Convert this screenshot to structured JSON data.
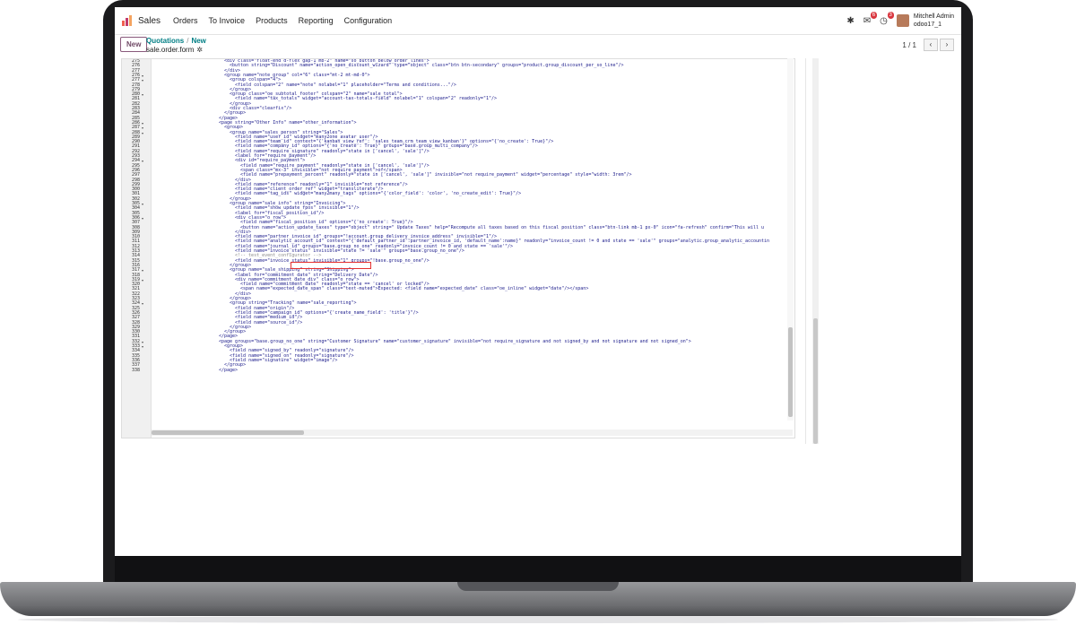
{
  "navbar": {
    "app_name": "Sales",
    "menu": [
      "Orders",
      "To Invoice",
      "Products",
      "Reporting",
      "Configuration"
    ],
    "chat_badge": "6",
    "activity_badge": "3",
    "user_name": "Mitchell Admin",
    "db_name": "odoo17_1",
    "icons": [
      "bug-icon",
      "chat-icon",
      "clock-icon"
    ]
  },
  "control": {
    "new_label": "New",
    "breadcrumb_parent": "Quotations",
    "breadcrumb_sep": "/",
    "breadcrumb_current": "New",
    "record_name": "sale.order.form",
    "pager": "1 / 1"
  },
  "code_lines": [
    {
      "n": "275",
      "fold": false,
      "indent": 96,
      "text": "<div class=\"float-end d-flex gap-1 mb-2\" name=\"so_button_below_order_lines\">"
    },
    {
      "n": "276",
      "fold": false,
      "indent": 102,
      "text": "<button string=\"Discount\" name=\"action_open_discount_wizard\" type=\"object\" class=\"btn btn-secondary\" groups=\"product.group_discount_per_so_line\"/>"
    },
    {
      "n": "277",
      "fold": false,
      "indent": 96,
      "text": "</div>"
    },
    {
      "n": "276",
      "fold": true,
      "indent": 96,
      "text": "<group name=\"note_group\" col=\"6\" class=\"mt-2 mt-md-0\">"
    },
    {
      "n": "277",
      "fold": true,
      "indent": 102,
      "text": "<group colspan=\"4\">"
    },
    {
      "n": "278",
      "fold": false,
      "indent": 108,
      "text": "<field colspan=\"2\" name=\"note\" nolabel=\"1\" placeholder=\"Terms and conditions...\"/>"
    },
    {
      "n": "279",
      "fold": false,
      "indent": 102,
      "text": "</group>"
    },
    {
      "n": "280",
      "fold": true,
      "indent": 102,
      "text": "<group class=\"oe_subtotal_footer\" colspan=\"2\" name=\"sale_total\">"
    },
    {
      "n": "281",
      "fold": false,
      "indent": 108,
      "text": "<field name=\"tax_totals\" widget=\"account-tax-totals-field\" nolabel=\"1\" colspan=\"2\" readonly=\"1\"/>"
    },
    {
      "n": "282",
      "fold": false,
      "indent": 102,
      "text": "</group>"
    },
    {
      "n": "283",
      "fold": false,
      "indent": 102,
      "text": "<div class=\"clearfix\"/>"
    },
    {
      "n": "284",
      "fold": false,
      "indent": 96,
      "text": "</group>"
    },
    {
      "n": "285",
      "fold": false,
      "indent": 90,
      "text": "</page>"
    },
    {
      "n": "286",
      "fold": true,
      "indent": 90,
      "text": "<page string=\"Other Info\" name=\"other_information\">"
    },
    {
      "n": "287",
      "fold": true,
      "indent": 96,
      "text": "<group>"
    },
    {
      "n": "288",
      "fold": true,
      "indent": 102,
      "text": "<group name=\"sales_person\" string=\"Sales\">"
    },
    {
      "n": "289",
      "fold": false,
      "indent": 108,
      "text": "<field name=\"user_id\" widget=\"many2one_avatar_user\"/>"
    },
    {
      "n": "290",
      "fold": false,
      "indent": 108,
      "text": "<field name=\"team_id\" context=\"{'kanban_view_ref': 'sales_team.crm_team_view_kanban'}\" options=\"{'no_create': True}\"/>"
    },
    {
      "n": "291",
      "fold": false,
      "indent": 108,
      "text": "<field name=\"company_id\" options=\"{'no_create': True}\" groups=\"base.group_multi_company\"/>"
    },
    {
      "n": "292",
      "fold": false,
      "indent": 108,
      "text": "<field name=\"require_signature\" readonly=\"state in ['cancel', 'sale']\"/>"
    },
    {
      "n": "293",
      "fold": false,
      "indent": 108,
      "text": "<label for=\"require_payment\"/>"
    },
    {
      "n": "294",
      "fold": true,
      "indent": 108,
      "text": "<div id=\"require_payment\">"
    },
    {
      "n": "295",
      "fold": false,
      "indent": 114,
      "text": "<field name=\"require_payment\" readonly=\"state in ['cancel', 'sale']\"/>"
    },
    {
      "n": "296",
      "fold": false,
      "indent": 114,
      "text": "<span class=\"mx-3\" invisible=\"not require_payment\">of</span>"
    },
    {
      "n": "297",
      "fold": false,
      "indent": 114,
      "text": "<field name=\"prepayment_percent\" readonly=\"state in ['cancel', 'sale']\" invisible=\"not require_payment\" widget=\"percentage\" style=\"width: 3rem\"/>"
    },
    {
      "n": "298",
      "fold": false,
      "indent": 108,
      "text": "</div>"
    },
    {
      "n": "299",
      "fold": false,
      "indent": 108,
      "text": "<field name=\"reference\" readonly=\"1\" invisible=\"not reference\"/>"
    },
    {
      "n": "300",
      "fold": false,
      "indent": 108,
      "text": "<field name=\"client_order_ref\" widget=\"transliterate\"/>"
    },
    {
      "n": "301",
      "fold": false,
      "indent": 108,
      "text": "<field name=\"tag_ids\" widget=\"many2many_tags\" options=\"{'color_field': 'color', 'no_create_edit': True}\"/>"
    },
    {
      "n": "302",
      "fold": false,
      "indent": 102,
      "text": "</group>"
    },
    {
      "n": "305",
      "fold": true,
      "indent": 102,
      "text": "<group name=\"sale_info\" string=\"Invoicing\">"
    },
    {
      "n": "304",
      "fold": false,
      "indent": 108,
      "text": "<field name=\"show_update_fpos\" invisible=\"1\"/>"
    },
    {
      "n": "305",
      "fold": false,
      "indent": 108,
      "text": "<label for=\"fiscal_position_id\"/>"
    },
    {
      "n": "306",
      "fold": true,
      "indent": 108,
      "text": "<div class=\"o_row\">"
    },
    {
      "n": "307",
      "fold": false,
      "indent": 114,
      "text": "<field name=\"fiscal_position_id\" options=\"{'no_create': True}\"/>"
    },
    {
      "n": "308",
      "fold": false,
      "indent": 114,
      "text": "<button name=\"action_update_taxes\" type=\"object\" string=\" Update Taxes\" help=\"Recompute all taxes based on this fiscal position\" class=\"btn-link mb-1 px-0\" icon=\"fa-refresh\" confirm=\"This will u"
    },
    {
      "n": "309",
      "fold": false,
      "indent": 108,
      "text": "</div>"
    },
    {
      "n": "310",
      "fold": false,
      "indent": 108,
      "text": "<field name=\"partner_invoice_id\" groups=\"!account.group_delivery_invoice_address\" invisible=\"1\"/>"
    },
    {
      "n": "311",
      "fold": false,
      "indent": 108,
      "text": "<field name=\"analytic_account_id\" context=\"{'default_partner_id':partner_invoice_id, 'default_name':name}\" readonly=\"invoice_count != 0 and state == 'sale'\" groups=\"analytic.group_analytic_accountin"
    },
    {
      "n": "312",
      "fold": false,
      "indent": 108,
      "text": "<field name=\"journal_id\" groups=\"base.group_no_one\" readonly=\"invoice_count != 0 and state == 'sale'\"/>"
    },
    {
      "n": "313",
      "fold": false,
      "indent": 108,
      "text": "<field name=\"invoice_status\" invisible=\"state != 'sale'\" groups=\"base.group_no_one\"/>"
    },
    {
      "n": "314",
      "fold": false,
      "indent": 108,
      "text": "<!-- test_event_configurator -->"
    },
    {
      "n": "315",
      "fold": false,
      "indent": 108,
      "text": "<field name=\"invoice_status\" invisible=\"1\" groups=\"!base.group_no_one\"/>"
    },
    {
      "n": "316",
      "fold": false,
      "indent": 102,
      "text": "</group>"
    },
    {
      "n": "317",
      "fold": true,
      "indent": 102,
      "text": "<group name=\"sale_shipping\" string=\"Shipping\">"
    },
    {
      "n": "318",
      "fold": false,
      "indent": 108,
      "text": "<label for=\"commitment_date\" string=\"Delivery Date\"/>"
    },
    {
      "n": "319",
      "fold": true,
      "indent": 108,
      "text": "<div name=\"commitment_date_div\" class=\"o_row\">"
    },
    {
      "n": "320",
      "fold": false,
      "indent": 114,
      "text": "<field name=\"commitment_date\" readonly=\"state == 'cancel' or locked\"/>"
    },
    {
      "n": "321",
      "fold": false,
      "indent": 114,
      "text": "<span name=\"expected_date_span\" class=\"text-muted\">Expected: <field name=\"expected_date\" class=\"oe_inline\" widget=\"date\"/></span>"
    },
    {
      "n": "322",
      "fold": false,
      "indent": 108,
      "text": "</div>"
    },
    {
      "n": "323",
      "fold": false,
      "indent": 102,
      "text": "</group>"
    },
    {
      "n": "324",
      "fold": true,
      "indent": 102,
      "text": "<group string=\"Tracking\" name=\"sale_reporting\">"
    },
    {
      "n": "325",
      "fold": false,
      "indent": 108,
      "text": "<field name=\"origin\"/>"
    },
    {
      "n": "326",
      "fold": false,
      "indent": 108,
      "text": "<field name=\"campaign_id\" options=\"{'create_name_field': 'title'}\"/>"
    },
    {
      "n": "327",
      "fold": false,
      "indent": 108,
      "text": "<field name=\"medium_id\"/>"
    },
    {
      "n": "328",
      "fold": false,
      "indent": 108,
      "text": "<field name=\"source_id\"/>"
    },
    {
      "n": "329",
      "fold": false,
      "indent": 102,
      "text": "</group>"
    },
    {
      "n": "330",
      "fold": false,
      "indent": 96,
      "text": "</group>"
    },
    {
      "n": "331",
      "fold": false,
      "indent": 90,
      "text": "</page>"
    },
    {
      "n": "332",
      "fold": true,
      "indent": 90,
      "text": "<page groups=\"base.group_no_one\" string=\"Customer Signature\" name=\"customer_signature\" invisible=\"not require_signature and not signed_by and not signature and not signed_on\">"
    },
    {
      "n": "333",
      "fold": true,
      "indent": 96,
      "text": "<group>"
    },
    {
      "n": "334",
      "fold": false,
      "indent": 102,
      "text": "<field name=\"signed_by\" readonly=\"signature\"/>"
    },
    {
      "n": "335",
      "fold": false,
      "indent": 102,
      "text": "<field name=\"signed_on\" readonly=\"signature\"/>"
    },
    {
      "n": "336",
      "fold": false,
      "indent": 102,
      "text": "<field name=\"signature\" widget=\"image\"/>"
    },
    {
      "n": "337",
      "fold": false,
      "indent": 96,
      "text": "</group>"
    },
    {
      "n": "338",
      "fold": false,
      "indent": 90,
      "text": "</page>"
    }
  ],
  "colors": {
    "accent": "#714b67",
    "link": "#017e84",
    "highlight_border": "#e53030"
  }
}
